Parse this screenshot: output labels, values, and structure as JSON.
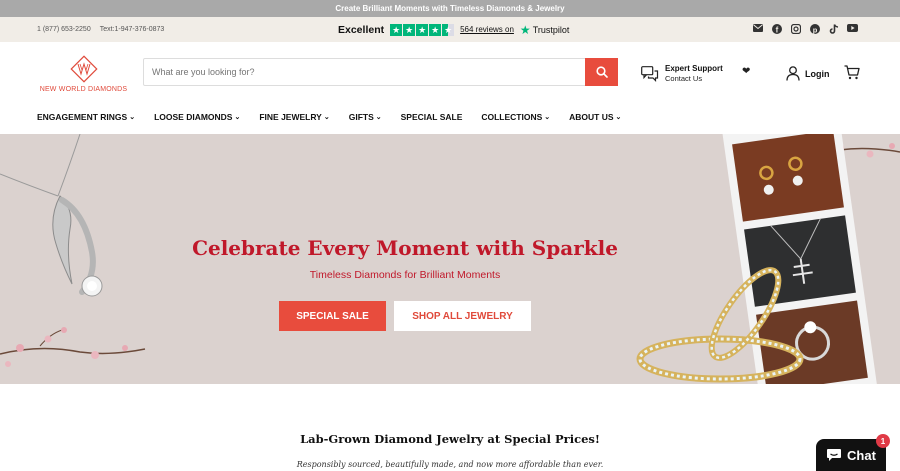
{
  "announcement": "Create Brilliant Moments with Timeless Diamonds & Jewelry",
  "utility": {
    "phone": "1 (877) 653-2250",
    "text_phone": "Text:1-947-376-0873",
    "rating_label": "Excellent",
    "reviews_link": "564 reviews on",
    "trustpilot": "Trustpilot",
    "social_icons": [
      "email-icon",
      "facebook-icon",
      "instagram-icon",
      "pinterest-icon",
      "tiktok-icon",
      "youtube-icon"
    ]
  },
  "header": {
    "logo_text": "NEW WORLD DIAMONDS",
    "search_placeholder": "What are you looking for?",
    "support_title": "Expert Support",
    "support_link": "Contact Us",
    "login_label": "Login"
  },
  "nav": [
    {
      "label": "ENGAGEMENT RINGS",
      "dropdown": true
    },
    {
      "label": "LOOSE DIAMONDS",
      "dropdown": true
    },
    {
      "label": "FINE JEWELRY",
      "dropdown": true
    },
    {
      "label": "GIFTS",
      "dropdown": true
    },
    {
      "label": "SPECIAL SALE",
      "dropdown": false
    },
    {
      "label": "COLLECTIONS",
      "dropdown": true
    },
    {
      "label": "ABOUT US",
      "dropdown": true
    }
  ],
  "hero": {
    "title": "Celebrate Every Moment with Sparkle",
    "subtitle": "Timeless Diamonds for Brilliant Moments",
    "primary_button": "SPECIAL SALE",
    "secondary_button": "SHOP ALL JEWELRY"
  },
  "section": {
    "heading": "Lab-Grown Diamond Jewelry at Special Prices!",
    "subheading": "Responsibly sourced, beautifully made, and now more affordable than ever."
  },
  "chat": {
    "label": "Chat",
    "badge": "1"
  },
  "colors": {
    "accent": "#e84c3d",
    "hero_text": "#c0182a",
    "trustpilot": "#00b67a",
    "hero_bg": "#dbd2cf"
  }
}
